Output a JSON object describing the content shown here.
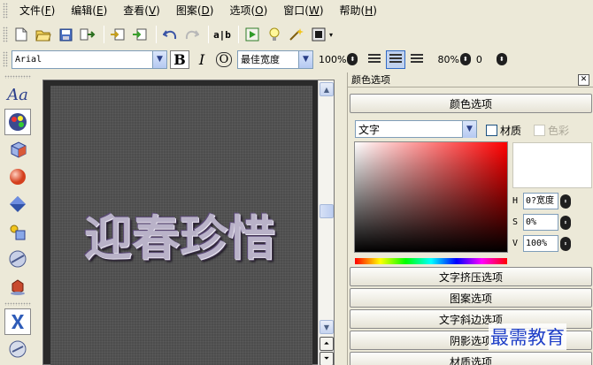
{
  "menu": [
    {
      "label": "文件(",
      "acc": "F",
      "tail": ")"
    },
    {
      "label": "编辑(",
      "acc": "E",
      "tail": ")"
    },
    {
      "label": "查看(",
      "acc": "V",
      "tail": ")"
    },
    {
      "label": "图案(",
      "acc": "D",
      "tail": ")"
    },
    {
      "label": "选项(",
      "acc": "O",
      "tail": ")"
    },
    {
      "label": "窗口(",
      "acc": "W",
      "tail": ")"
    },
    {
      "label": "帮助(",
      "acc": "H",
      "tail": ")"
    }
  ],
  "toolbar": {
    "ab_label": "a|b"
  },
  "format": {
    "font": "Arial",
    "bold": "B",
    "italic": "I",
    "outline": "O",
    "width_mode": "最佳宽度",
    "scale": "100%",
    "zoom": "80%",
    "spacing": "0"
  },
  "palette": {
    "text_tool": "Aa"
  },
  "canvas": {
    "text": "迎春珍惜"
  },
  "panel": {
    "title": "颜色选项",
    "color_section": "颜色选项",
    "target": "文字",
    "material_label": "材质",
    "color_label": "色彩",
    "h_label": "H",
    "h_value": "0?宽度",
    "s_label": "S",
    "s_value": "0%",
    "v_label": "V",
    "v_value": "100%",
    "sections": [
      "文字挤压选项",
      "图案选项",
      "文字斜边选项",
      "阴影选项",
      "材质选项"
    ]
  },
  "watermark": "最需教育",
  "colors": {
    "background": "#ece9d8",
    "canvas": "#4d4d4d",
    "hue_base": "#ff0000",
    "watermark": "#2040c8"
  }
}
